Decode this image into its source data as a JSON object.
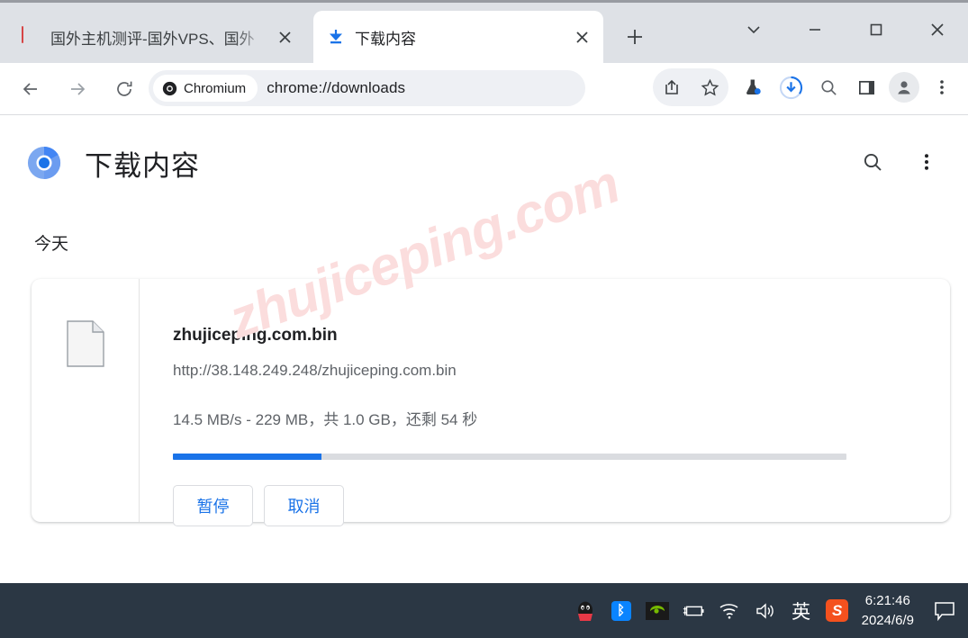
{
  "window": {
    "controls": [
      {
        "name": "tab-search",
        "icon": "chevron-down-icon"
      },
      {
        "name": "minimize",
        "icon": "minimize-icon"
      },
      {
        "name": "maximize",
        "icon": "maximize-icon"
      },
      {
        "name": "close",
        "icon": "close-icon"
      }
    ]
  },
  "tabs": [
    {
      "title": "国外主机测评-国外VPS、国外",
      "icon": "site-favicon",
      "active": false
    },
    {
      "title": "下载内容",
      "icon": "download-icon",
      "active": true
    }
  ],
  "newtab_label": "+",
  "toolbar": {
    "back": "←",
    "forward": "→",
    "reload": "⟳",
    "chip_label": "Chromium",
    "url": "chrome://downloads",
    "icons": [
      "share-icon",
      "star-icon",
      "flask-icon",
      "download-progress-icon",
      "search-icon",
      "side-panel-icon",
      "profile-icon",
      "menu-icon"
    ]
  },
  "page": {
    "title": "下载内容",
    "header_icons": [
      "search-icon",
      "more-vertical-icon"
    ],
    "section_label": "今天",
    "watermark": "zhujiceping.com",
    "download": {
      "file_name": "zhujiceping.com.bin",
      "url": "http://38.148.249.248/zhujiceping.com.bin",
      "status": "14.5 MB/s - 229 MB，共 1.0 GB，还剩 54 秒",
      "speed": "14.5 MB/s",
      "downloaded": "229 MB",
      "total": "1.0 GB",
      "remaining": "54 秒",
      "progress_percent": 22,
      "progress_color": "#1a73e8",
      "buttons": [
        {
          "label": "暂停",
          "name": "pause-button"
        },
        {
          "label": "取消",
          "name": "cancel-button"
        }
      ]
    }
  },
  "taskbar": {
    "tray_icons": [
      "qq-icon",
      "bluetooth-icon",
      "nvidia-icon",
      "battery-icon",
      "wifi-icon",
      "volume-icon",
      "ime-icon",
      "sogou-icon"
    ],
    "ime_label": "英",
    "sogou_label": "S",
    "time": "6:21:46",
    "date": "2024/6/9",
    "notification_icon": "notification-icon"
  },
  "colors": {
    "tabstrip_bg": "#dee1e6",
    "taskbar_bg": "#2b3744",
    "accent_blue": "#1a73e8",
    "watermark_pink": "#fbdddd"
  }
}
